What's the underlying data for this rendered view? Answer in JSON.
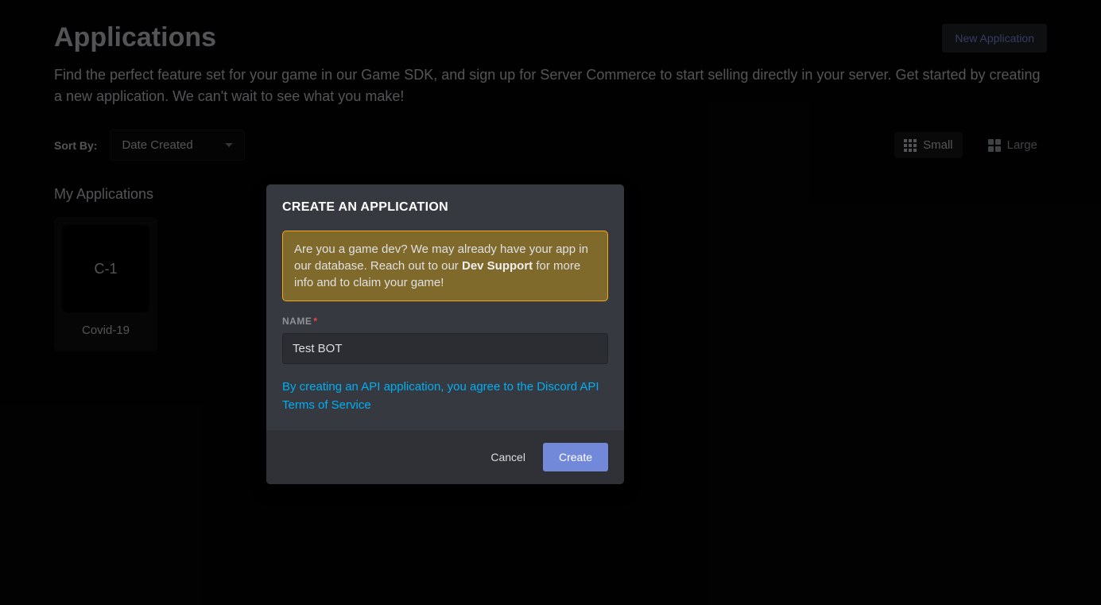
{
  "header": {
    "title": "Applications",
    "new_app_label": "New Application"
  },
  "description": "Find the perfect feature set for your game in our Game SDK, and sign up for Server Commerce to start selling directly in your server. Get started by creating a new application. We can't wait to see what you make!",
  "sort": {
    "label": "Sort By:",
    "value": "Date Created"
  },
  "view": {
    "small": "Small",
    "large": "Large"
  },
  "section": {
    "my_apps": "My Applications"
  },
  "apps": [
    {
      "abbrev": "C-1",
      "name": "Covid-19"
    }
  ],
  "modal": {
    "title": "CREATE AN APPLICATION",
    "notice_pre": "Are you a game dev? We may already have your app in our database. Reach out to our ",
    "notice_bold": "Dev Support",
    "notice_post": " for more info and to claim your game!",
    "name_label": "NAME",
    "name_value": "Test BOT",
    "tos_text": "By creating an API application, you agree to the Discord API Terms of Service",
    "cancel": "Cancel",
    "create": "Create"
  }
}
